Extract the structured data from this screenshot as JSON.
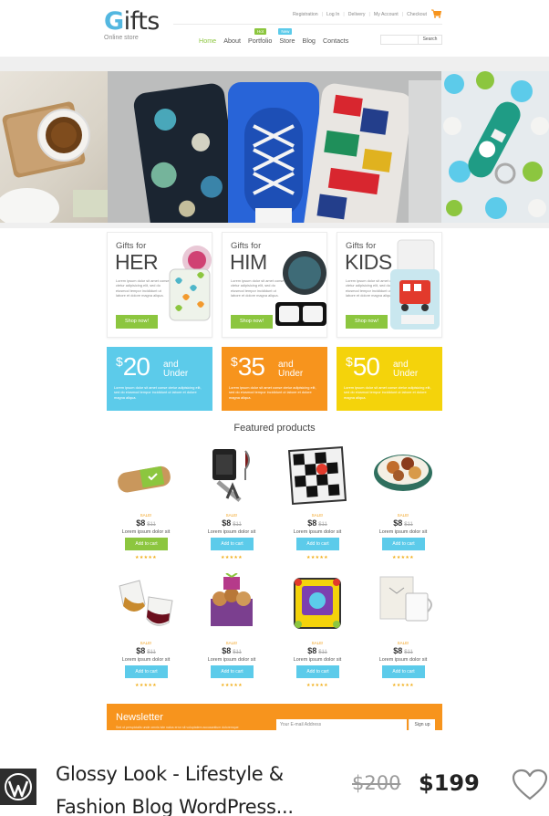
{
  "header": {
    "logo_word_rest": "ifts",
    "logo_g": "G",
    "logo_sub": "Online store",
    "top_links": [
      "Registration",
      "Log In",
      "Delivery",
      "My Account",
      "Checkout"
    ],
    "nav": [
      {
        "label": "Home",
        "active": true
      },
      {
        "label": "About"
      },
      {
        "label": "Portfolio",
        "badge": "Hot",
        "badge_color": "#8cc63f"
      },
      {
        "label": "Store",
        "badge": "New",
        "badge_color": "#5ccbea"
      },
      {
        "label": "Blog"
      },
      {
        "label": "Contacts"
      }
    ],
    "search_button": "Search"
  },
  "categories": [
    {
      "small": "Gifts for",
      "big": "HER",
      "text": "Lorem ipsum dolor sit amet conse ctetur adipisicing elit, sed do eiusmod tempor incididunt ut labore et dolore magna aliqua.",
      "button": "Shop now!"
    },
    {
      "small": "Gifts for",
      "big": "HIM",
      "text": "Lorem ipsum dolor sit amet conse ctetur adipisicing elit, sed do eiusmod tempor incididunt ut labore et dolore magna aliqua.",
      "button": "Shop now!"
    },
    {
      "small": "Gifts for",
      "big": "KIDS",
      "text": "Lorem ipsum dolor sit amet conse ctetur adipisicing elit, sed do eiusmod tempor incididunt ut labore et dolore magna aliqua.",
      "button": "Shop now!"
    }
  ],
  "price_tiles": [
    {
      "currency": "$",
      "amount": "20",
      "line1": "and",
      "line2": "Under",
      "text": "Lorem ipsum dolor sit amet conse ctetur adipisicing elit, sed do eiusmod tempor incididunt ut labore et dolore magna aliqua.",
      "color": "#5ccbea"
    },
    {
      "currency": "$",
      "amount": "35",
      "line1": "and",
      "line2": "Under",
      "text": "Lorem ipsum dolor sit amet conse ctetur adipisicing elit, sed do eiusmod tempor incididunt ut labore et dolore magna aliqua.",
      "color": "#f7941d"
    },
    {
      "currency": "$",
      "amount": "50",
      "line1": "and",
      "line2": "Under",
      "text": "Lorem ipsum dolor sit amet conse ctetur adipisicing elit, sed do eiusmod tempor incididunt ut labore et dolore magna aliqua.",
      "color": "#f4d30b"
    }
  ],
  "featured": {
    "title": "Featured products",
    "products": [
      {
        "sale": "SALE!",
        "price": "$8",
        "old": "$11",
        "name": "Lorem ipsum dolor sit",
        "button": "Add to cart",
        "stars": "★★★★★",
        "icon": "wooden-box-icon"
      },
      {
        "sale": "SALE!",
        "price": "$8",
        "old": "$11",
        "name": "Lorem ipsum dolor sit",
        "button": "Add to cart",
        "stars": "★★★★★",
        "icon": "wine-set-icon"
      },
      {
        "sale": "SALE!",
        "price": "$8",
        "old": "$11",
        "name": "Lorem ipsum dolor sit",
        "button": "Add to cart",
        "stars": "★★★★★",
        "icon": "play-mat-icon"
      },
      {
        "sale": "SALE!",
        "price": "$8",
        "old": "$11",
        "name": "Lorem ipsum dolor sit",
        "button": "Add to cart",
        "stars": "★★★★★",
        "icon": "snack-tray-icon"
      },
      {
        "sale": "SALE!",
        "price": "$8",
        "old": "$11",
        "name": "Lorem ipsum dolor sit",
        "button": "Add to cart",
        "stars": "★★★★★",
        "icon": "glasses-icon"
      },
      {
        "sale": "SALE!",
        "price": "$8",
        "old": "$11",
        "name": "Lorem ipsum dolor sit",
        "button": "Add to cart",
        "stars": "★★★★★",
        "icon": "cookie-box-icon"
      },
      {
        "sale": "SALE!",
        "price": "$8",
        "old": "$11",
        "name": "Lorem ipsum dolor sit",
        "button": "Add to cart",
        "stars": "★★★★★",
        "icon": "toy-cube-icon"
      },
      {
        "sale": "SALE!",
        "price": "$8",
        "old": "$11",
        "name": "Lorem ipsum dolor sit",
        "button": "Add to cart",
        "stars": "★★★★★",
        "icon": "mugs-icon"
      }
    ]
  },
  "newsletter": {
    "title": "Newsletter",
    "small": "Sed ut perspiciatis unde omnis iste natus error sit voluptatem accusantium doloremque",
    "placeholder": "Your E-mail Address",
    "button": "Sign up"
  },
  "listing": {
    "title": "Glossy Look - Lifestyle & Fashion Blog WordPress...",
    "old_price": "$200",
    "new_price": "$199"
  },
  "colors": {
    "green": "#8cc63f",
    "blue": "#5ccbea",
    "orange": "#f7941d",
    "yellow": "#f4d30b"
  }
}
